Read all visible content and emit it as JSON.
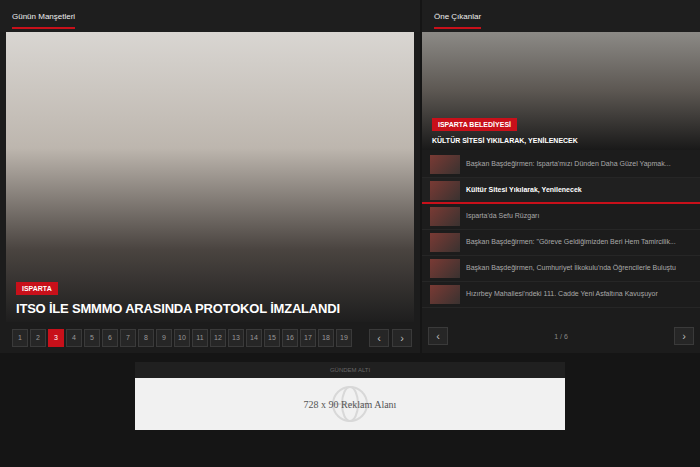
{
  "headlines": {
    "title": "Günün Manşetleri",
    "slide": {
      "badge": "ISPARTA",
      "title": "ITSO İLE SMMMO ARASINDA PROTOKOL İMZALANDI"
    },
    "pages": [
      {
        "label": "1",
        "selected": false
      },
      {
        "label": "2",
        "selected": false
      },
      {
        "label": "3",
        "selected": true
      },
      {
        "label": "4",
        "selected": false
      },
      {
        "label": "5",
        "selected": false
      },
      {
        "label": "6",
        "selected": false
      },
      {
        "label": "7",
        "selected": false
      },
      {
        "label": "8",
        "selected": false
      },
      {
        "label": "9",
        "selected": false
      },
      {
        "label": "10",
        "selected": false
      },
      {
        "label": "11",
        "selected": false
      },
      {
        "label": "12",
        "selected": false
      },
      {
        "label": "13",
        "selected": false
      },
      {
        "label": "14",
        "selected": false
      },
      {
        "label": "15",
        "selected": false
      },
      {
        "label": "16",
        "selected": false
      },
      {
        "label": "17",
        "selected": false
      },
      {
        "label": "18",
        "selected": false
      },
      {
        "label": "19",
        "selected": false
      }
    ],
    "prev": "‹",
    "next": "›"
  },
  "featured": {
    "title": "Öne Çıkanlar",
    "current": {
      "badge": "ISPARTA BELEDİYESİ",
      "title": "KÜLTÜR SİTESİ YIKILARAK, YENİLENECEK"
    },
    "items": [
      {
        "title": "Başkan Başdeğirmen: Isparta'mızı Dünden Daha Güzel Yapmak...",
        "selected": false
      },
      {
        "title": "Kültür Sitesi Yıkılarak, Yenilenecek",
        "selected": true
      },
      {
        "title": "Isparta'da Sefu Rüzgarı",
        "selected": false
      },
      {
        "title": "Başkan Başdeğirmen: \"Göreve Geldiğimizden Beri Hem Tamircilik...",
        "selected": false
      },
      {
        "title": "Başkan Başdeğirmen, Cumhuriyet İlkokulu'nda Öğrencilerle Buluştu",
        "selected": false
      },
      {
        "title": "Hızırbey Mahallesi'ndeki 111. Cadde Yeni Asfaltına Kavuşuyor",
        "selected": false
      }
    ],
    "prev": "‹",
    "next": "›",
    "counter": "1 / 6"
  },
  "ad": {
    "label": "GÜNDEM ALTI",
    "text": "728 x 90 Reklam Alanı"
  }
}
